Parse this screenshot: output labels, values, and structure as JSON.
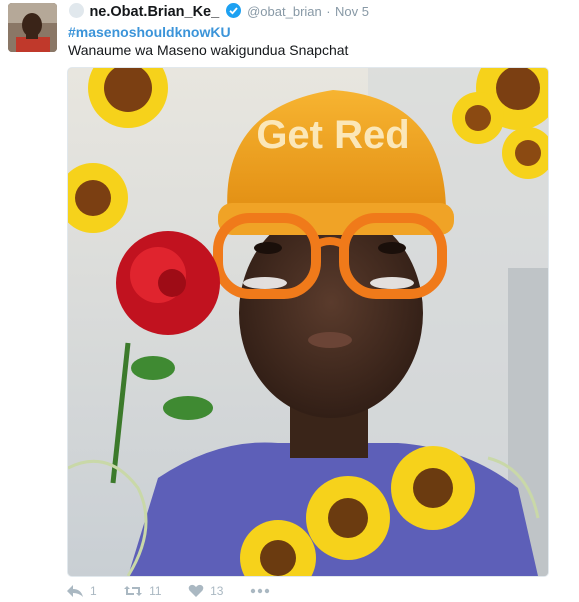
{
  "tweet": {
    "display_name": "ne.Obat.Brian_Ke_",
    "handle": "@obat_brian",
    "separator": "·",
    "timestamp": "Nov 5",
    "hashtag": "#masenoshouldknowKU",
    "text": "Wanaume wa Maseno wakigundua Snapchat"
  },
  "media": {
    "cap_text": "Get Red",
    "icon": "snapchat-filter-photo"
  },
  "actions": {
    "reply_count": "1",
    "retweet_count": "11",
    "like_count": "13",
    "icons": [
      "reply-icon",
      "retweet-icon",
      "like-icon",
      "more-icon"
    ]
  },
  "colors": {
    "link": "#3b94d9",
    "verified": "#1da1f2",
    "muted": "#8899a6",
    "action": "#aab8c2"
  }
}
